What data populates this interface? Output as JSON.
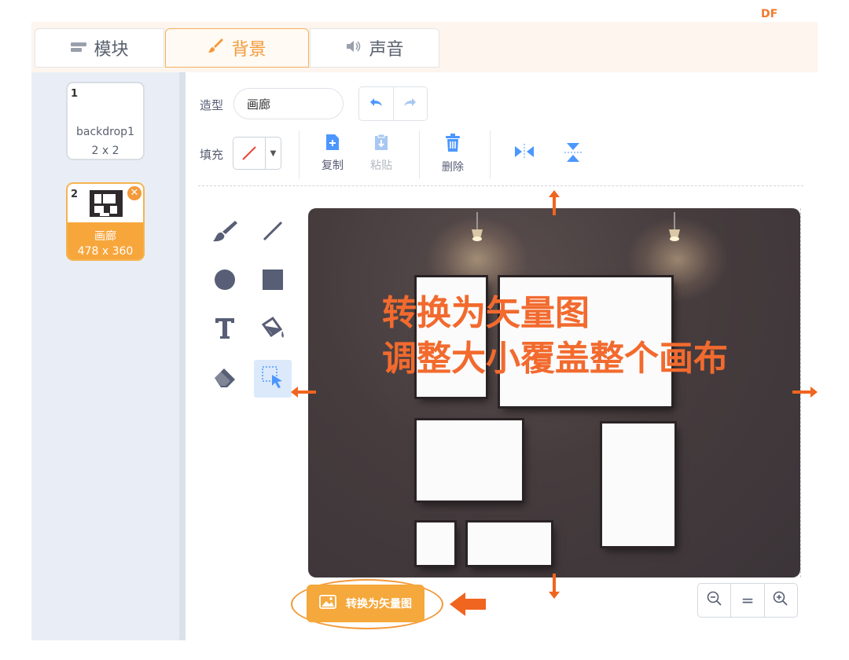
{
  "brand": {
    "logo_text": "DF"
  },
  "tabs": [
    {
      "label": "模块",
      "icon": "blocks-icon"
    },
    {
      "label": "背景",
      "icon": "brush-icon",
      "active": true
    },
    {
      "label": "声音",
      "icon": "speaker-icon"
    }
  ],
  "backdrops": [
    {
      "number": "1",
      "name": "backdrop1",
      "size": "2 x 2"
    },
    {
      "number": "2",
      "name": "画廊",
      "size": "478 x 360",
      "selected": true
    }
  ],
  "editor": {
    "costume_label": "造型",
    "costume_name": "画廊",
    "fill_label": "填充",
    "copy_label": "复制",
    "paste_label": "粘贴",
    "delete_label": "删除"
  },
  "annotation": {
    "line1": "转换为矢量图",
    "line2": "调整大小覆盖整个画布"
  },
  "convert_button": {
    "label": "转换为矢量图"
  },
  "zoom": {
    "zoom_out": "−",
    "reset": "=",
    "zoom_in": "+"
  },
  "colors": {
    "accent": "#f5a83b",
    "annotation": "#f26a2e",
    "tool_blue": "#4c97ff"
  }
}
